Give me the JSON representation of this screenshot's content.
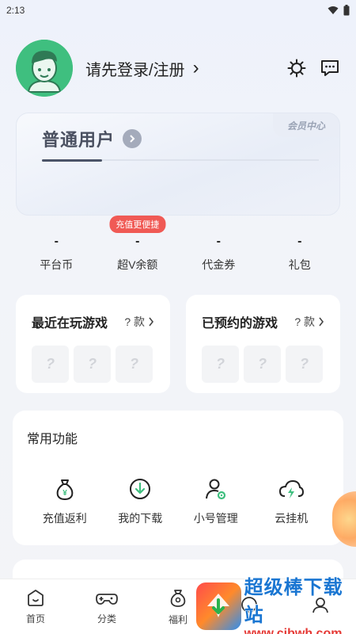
{
  "status_bar": {
    "time": "2:13"
  },
  "profile": {
    "login_text": "请先登录/注册",
    "chevron": "›"
  },
  "member_card": {
    "tag": "会员中心",
    "title": "普通用户"
  },
  "stats": {
    "badge": "充值更便捷",
    "items": [
      {
        "value": "-",
        "label": "平台币"
      },
      {
        "value": "-",
        "label": "超V余额"
      },
      {
        "value": "-",
        "label": "代金券"
      },
      {
        "value": "-",
        "label": "礼包"
      }
    ]
  },
  "recent_games": {
    "title": "最近在玩游戏",
    "count": "? 款",
    "slots": [
      "?",
      "?",
      "?"
    ]
  },
  "reserved_games": {
    "title": "已预约的游戏",
    "count": "? 款",
    "slots": [
      "?",
      "?",
      "?"
    ]
  },
  "functions": {
    "title": "常用功能",
    "items": [
      {
        "label": "充值返利",
        "icon": "money-bag-icon"
      },
      {
        "label": "我的下载",
        "icon": "download-icon"
      },
      {
        "label": "小号管理",
        "icon": "user-gear-icon"
      },
      {
        "label": "云挂机",
        "icon": "cloud-bolt-icon"
      }
    ]
  },
  "bottom_nav": {
    "items": [
      {
        "label": "首页",
        "icon": "home-icon"
      },
      {
        "label": "分类",
        "icon": "gamepad-icon"
      },
      {
        "label": "福利",
        "icon": "gift-bag-icon"
      },
      {
        "label": "",
        "icon": "trade-icon"
      },
      {
        "label": "",
        "icon": "me-icon"
      }
    ]
  },
  "watermark": {
    "main": "超级棒下载站",
    "url": "www.cjbwh.com"
  },
  "colors": {
    "accent_green": "#3fbf7f",
    "badge_red": "#f05a55",
    "watermark_blue": "#1a76d2"
  }
}
